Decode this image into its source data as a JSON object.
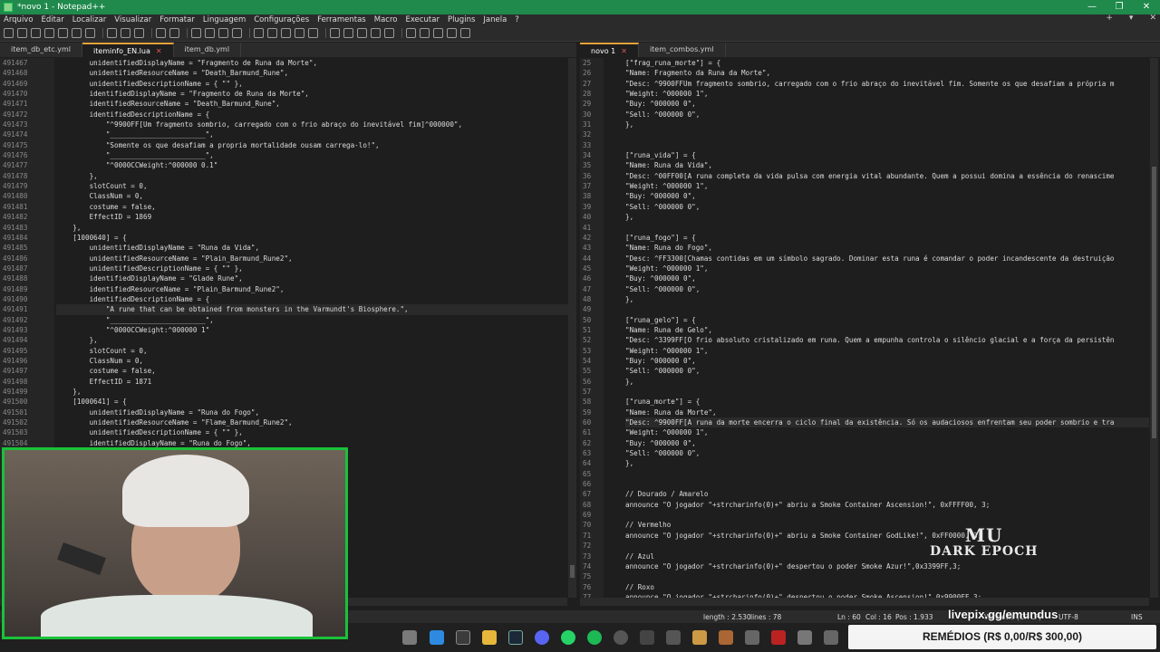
{
  "window": {
    "title": "*novo 1 - Notepad++",
    "controls": [
      "—",
      "❐",
      "✕"
    ]
  },
  "menu": {
    "items": [
      "Arquivo",
      "Editar",
      "Localizar",
      "Visualizar",
      "Formatar",
      "Linguagem",
      "Configurações",
      "Ferramentas",
      "Macro",
      "Executar",
      "Plugins",
      "Janela",
      "?"
    ],
    "right": [
      "+",
      "▾",
      "✕"
    ]
  },
  "left_tabs": [
    {
      "label": "item_db_etc.yml",
      "active": false
    },
    {
      "label": "iteminfo_EN.lua",
      "active": true
    },
    {
      "label": "item_db.yml",
      "active": false
    }
  ],
  "right_tabs": [
    {
      "label": "novo 1",
      "active": true
    },
    {
      "label": "item_combos.yml",
      "active": false
    }
  ],
  "left_editor": {
    "line_numbers": [
      "491467",
      "491468",
      "491469",
      "491470",
      "491471",
      "491472",
      "491473",
      "491474",
      "491475",
      "491476",
      "491477",
      "491478",
      "491479",
      "491480",
      "491481",
      "491482",
      "491483",
      "491484",
      "491485",
      "491486",
      "491487",
      "491488",
      "491489",
      "491490",
      "491491",
      "491492",
      "491493",
      "491494",
      "491495",
      "491496",
      "491497",
      "491498",
      "491499",
      "491500",
      "491501",
      "491502",
      "491503",
      "491504"
    ],
    "lines": [
      "        unidentifiedDisplayName = \"Fragmento de Runa da Morte\",",
      "        unidentifiedResourceName = \"Death_Barmund_Rune\",",
      "        unidentifiedDescriptionName = { \"\" },",
      "        identifiedDisplayName = \"Fragmento de Runa da Morte\",",
      "        identifiedResourceName = \"Death_Barmund_Rune\",",
      "        identifiedDescriptionName = {",
      "            \"^9900FF[Um fragmento sombrio, carregado com o frio abraço do inevitável fim]^000000\",",
      "            \"_______________________\",",
      "            \"Somente os que desafiam a propria mortalidade ousam carrega-lo!\",",
      "            \"_______________________\",",
      "            \"^0000CCWeight:^000000 0.1\"",
      "        },",
      "        slotCount = 0,",
      "        ClassNum = 0,",
      "        costume = false,",
      "        EffectID = 1869",
      "    },",
      "    [1000640] = {",
      "        unidentifiedDisplayName = \"Runa da Vida\",",
      "        unidentifiedResourceName = \"Plain_Barmund_Rune2\",",
      "        unidentifiedDescriptionName = { \"\" },",
      "        identifiedDisplayName = \"Glade Rune\",",
      "        identifiedResourceName = \"Plain_Barmund_Rune2\",",
      "        identifiedDescriptionName = {",
      "            \"A rune that can be obtained from monsters in the Varmundt's Biosphere.\",",
      "            \"_______________________\",",
      "            \"^0000CCWeight:^000000 1\"",
      "        },",
      "        slotCount = 0,",
      "        ClassNum = 0,",
      "        costume = false,",
      "        EffectID = 1871",
      "    },",
      "    [1000641] = {",
      "        unidentifiedDisplayName = \"Runa do Fogo\",",
      "        unidentifiedResourceName = \"Flame_Barmund_Rune2\",",
      "        unidentifiedDescriptionName = { \"\" },",
      "        identifiedDisplayName = \"Runa do Fogo\","
    ],
    "hidden_tail": "undt's Biosphere.\","
  },
  "right_editor": {
    "line_numbers": [
      "25",
      "26",
      "27",
      "28",
      "29",
      "30",
      "31",
      "32",
      "33",
      "34",
      "35",
      "36",
      "37",
      "38",
      "39",
      "40",
      "41",
      "42",
      "43",
      "44",
      "45",
      "46",
      "47",
      "48",
      "49",
      "50",
      "51",
      "52",
      "53",
      "54",
      "55",
      "56",
      "57",
      "58",
      "59",
      "60",
      "61",
      "62",
      "63",
      "64",
      "65",
      "66",
      "67",
      "68",
      "69",
      "70",
      "71",
      "72",
      "73",
      "74",
      "75",
      "76",
      "77"
    ],
    "lines": [
      "[\"frag_runa_morte\"] = {",
      "\"Name: Fragmento da Runa da Morte\",",
      "\"Desc: ^9900FFUm fragmento sombrio, carregado com o frio abraço do inevitável fim. Somente os que desafiam a própria m",
      "\"Weight: ^000000 1\",",
      "\"Buy: ^000000 0\",",
      "\"Sell: ^000000 0\",",
      "},",
      "",
      "",
      "[\"runa_vida\"] = {",
      "\"Name: Runa da Vida\",",
      "\"Desc: ^00FF00[A runa completa da vida pulsa com energia vital abundante. Quem a possui domina a essência do renascime",
      "\"Weight: ^000000 1\",",
      "\"Buy: ^000000 0\",",
      "\"Sell: ^000000 0\",",
      "},",
      "",
      "[\"runa_fogo\"] = {",
      "\"Name: Runa do Fogo\",",
      "\"Desc: ^FF3300[Chamas contidas em um símbolo sagrado. Dominar esta runa é comandar o poder incandescente da destruição",
      "\"Weight: ^000000 1\",",
      "\"Buy: ^000000 0\",",
      "\"Sell: ^000000 0\",",
      "},",
      "",
      "[\"runa_gelo\"] = {",
      "\"Name: Runa de Gelo\",",
      "\"Desc: ^3399FF[O frio absoluto cristalizado em runa. Quem a empunha controla o silêncio glacial e a força da persistên",
      "\"Weight: ^000000 1\",",
      "\"Buy: ^000000 0\",",
      "\"Sell: ^000000 0\",",
      "},",
      "",
      "[\"runa_morte\"] = {",
      "\"Name: Runa da Morte\",",
      "\"Desc: ^9900FF[A runa da morte encerra o ciclo final da existência. Só os audaciosos enfrentam seu poder sombrio e tra",
      "\"Weight: ^000000 1\",",
      "\"Buy: ^000000 0\",",
      "\"Sell: ^000000 0\",",
      "},",
      "",
      "",
      "// Dourado / Amarelo",
      "announce \"O jogador \"+strcharinfo(0)+\" abriu a Smoke Container Ascension!\", 0xFFFF00, 3;",
      "",
      "// Vermelho",
      "announce \"O jogador \"+strcharinfo(0)+\" abriu a Smoke Container GodLike!\", 0xFF0000, 3;",
      "",
      "// Azul",
      "announce \"O jogador \"+strcharinfo(0)+\" despertou o poder Smoke Azur!\",0x3399FF,3;",
      "",
      "// Roxo",
      "announce \"O jogador \"+strcharinfo(0)+\" despertou o poder Smoke Ascension!\",0x9900FF,3;"
    ]
  },
  "status": {
    "length": "length : 2.530",
    "lines": "lines : 78",
    "ln": "Ln : 60",
    "col": "Col : 16",
    "pos": "Pos : 1.933",
    "eol": "Windows (CR LF)",
    "encoding": "UTF-8",
    "mode": "INS"
  },
  "overlay": {
    "logo_top": "MU",
    "logo_bottom": "DARK EPOCH",
    "livepix": "livepix.gg/emundus",
    "remedios": "REMÉDIOS (R$ 0,00/R$ 300,00)"
  },
  "colors": {
    "titlebar": "#1f8a4c",
    "editor_bg": "#1e1e1e",
    "tab_accent": "#e8a33a",
    "webcam_border": "#19c23a"
  }
}
